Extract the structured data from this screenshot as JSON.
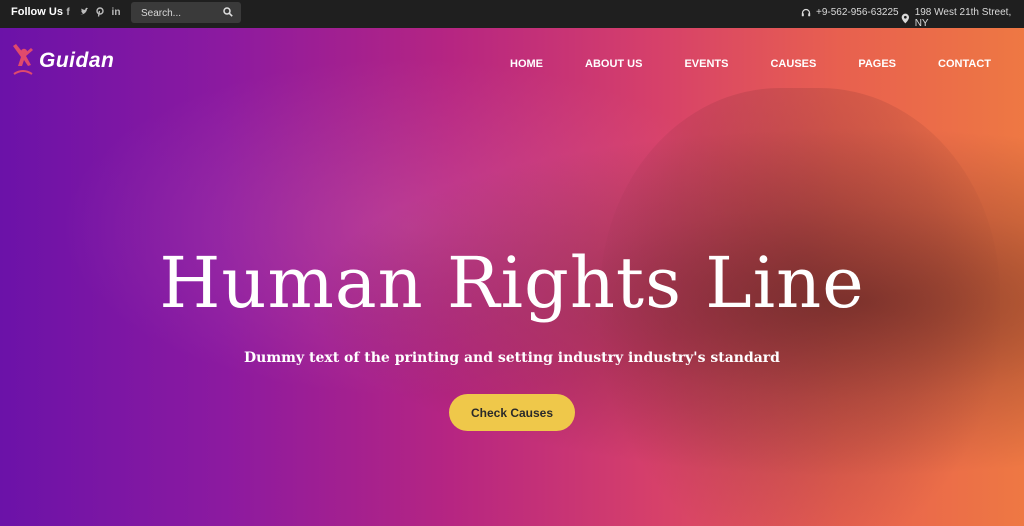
{
  "topbar": {
    "follow_label": "Follow Us",
    "social_icons": [
      "facebook-icon",
      "twitter-icon",
      "pinterest-icon",
      "linkedin-icon"
    ],
    "search": {
      "placeholder": "Search..."
    },
    "phone": "+9-562-956-63225",
    "address": "198 West 21th Street, NY"
  },
  "header": {
    "logo_text": "Guidan",
    "nav": [
      "HOME",
      "ABOUT US",
      "EVENTS",
      "CAUSES",
      "PAGES",
      "CONTACT"
    ]
  },
  "hero": {
    "title": "Human Rights Line",
    "subtitle": "Dummy text of the printing and setting industry industry's standard",
    "cta_label": "Check Causes"
  },
  "colors": {
    "topbar_bg": "#1f1f1f",
    "cta_bg": "#efc84a",
    "logo_accent": "#e04a6c"
  }
}
